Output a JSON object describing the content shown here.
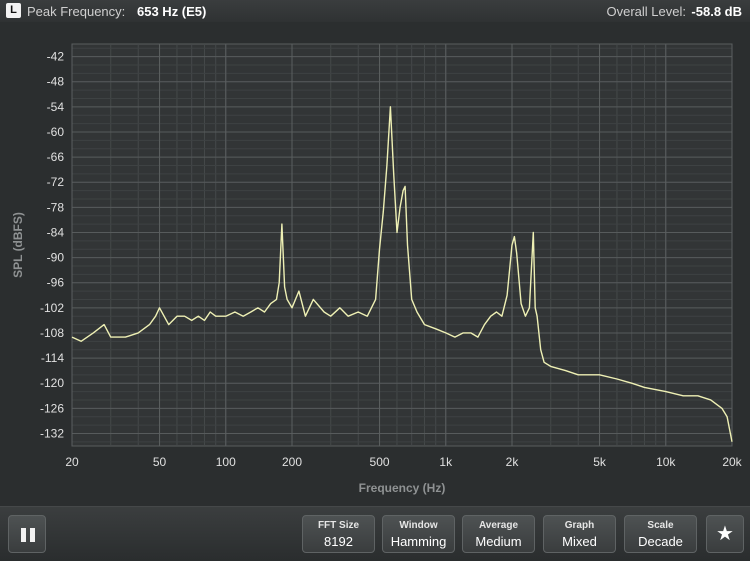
{
  "header": {
    "channel": "L",
    "peak_label": "Peak Frequency:",
    "peak_value": "653 Hz (E5)",
    "level_label": "Overall Level:",
    "level_value": "-58.8 dB"
  },
  "chart_data": {
    "type": "line",
    "title": "",
    "xlabel": "Frequency (Hz)",
    "ylabel": "SPL (dBFS)",
    "x_scale": "log",
    "xlim": [
      20,
      20000
    ],
    "ylim": [
      -135,
      -39
    ],
    "grid": true,
    "line_color": "#eef0b4",
    "x_ticks": [
      {
        "value": 20,
        "label": "20"
      },
      {
        "value": 50,
        "label": "50"
      },
      {
        "value": 100,
        "label": "100"
      },
      {
        "value": 200,
        "label": "200"
      },
      {
        "value": 500,
        "label": "500"
      },
      {
        "value": 1000,
        "label": "1k"
      },
      {
        "value": 2000,
        "label": "2k"
      },
      {
        "value": 5000,
        "label": "5k"
      },
      {
        "value": 10000,
        "label": "10k"
      },
      {
        "value": 20000,
        "label": "20k"
      }
    ],
    "y_ticks": [
      -42,
      -48,
      -54,
      -60,
      -66,
      -72,
      -78,
      -84,
      -90,
      -96,
      -102,
      -108,
      -114,
      -120,
      -126,
      -132
    ],
    "series": [
      {
        "x": [
          20,
          22,
          25,
          28,
          30,
          35,
          40,
          45,
          48,
          50,
          55,
          60,
          65,
          70,
          75,
          80,
          85,
          90,
          100,
          110,
          120,
          130,
          140,
          150,
          160,
          170,
          175,
          180,
          185,
          190,
          200,
          215,
          230,
          250,
          280,
          300,
          330,
          360,
          400,
          440,
          480,
          500,
          520,
          540,
          560,
          580,
          600,
          620,
          640,
          653,
          670,
          700,
          740,
          800,
          900,
          1000,
          1100,
          1200,
          1300,
          1400,
          1500,
          1600,
          1700,
          1800,
          1900,
          2000,
          2050,
          2100,
          2150,
          2200,
          2300,
          2400,
          2500,
          2550,
          2600,
          2700,
          2800,
          3000,
          3500,
          4000,
          5000,
          6000,
          7000,
          8000,
          10000,
          12000,
          14000,
          16000,
          18000,
          19000,
          20000
        ],
        "y": [
          -109,
          -110,
          -108,
          -106,
          -109,
          -109,
          -108,
          -106,
          -104,
          -102,
          -106,
          -104,
          -104,
          -105,
          -104,
          -105,
          -103,
          -104,
          -104,
          -103,
          -104,
          -103,
          -102,
          -103,
          -101,
          -100,
          -96,
          -82,
          -97,
          -100,
          -102,
          -98,
          -104,
          -100,
          -103,
          -104,
          -102,
          -104,
          -103,
          -104,
          -100,
          -88,
          -79,
          -68,
          -54,
          -70,
          -84,
          -78,
          -74,
          -73,
          -87,
          -100,
          -103,
          -106,
          -107,
          -108,
          -109,
          -108,
          -108,
          -109,
          -106,
          -104,
          -103,
          -104,
          -99,
          -87,
          -85,
          -89,
          -95,
          -101,
          -104,
          -102,
          -84,
          -102,
          -104,
          -112,
          -115,
          -116,
          -117,
          -118,
          -118,
          -119,
          -120,
          -121,
          -122,
          -123,
          -123,
          -124,
          -126,
          -128,
          -134
        ]
      }
    ]
  },
  "controls": [
    {
      "label": "FFT Size",
      "value": "8192"
    },
    {
      "label": "Window",
      "value": "Hamming"
    },
    {
      "label": "Average",
      "value": "Medium"
    },
    {
      "label": "Graph",
      "value": "Mixed"
    },
    {
      "label": "Scale",
      "value": "Decade"
    }
  ],
  "icons": {
    "pause": "pause-icon",
    "star": "star-icon",
    "star_glyph": "★"
  }
}
